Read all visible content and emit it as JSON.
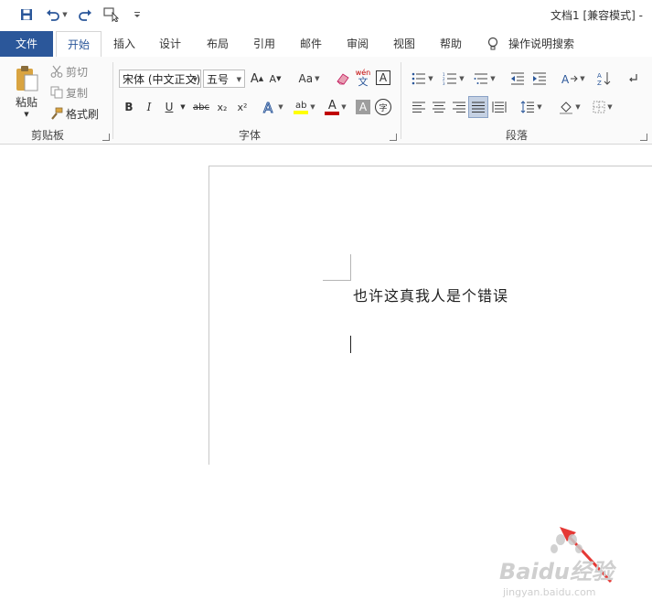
{
  "title_bar": {
    "doc_title": "文档1 [兼容模式] -"
  },
  "tabs": [
    "文件",
    "开始",
    "插入",
    "设计",
    "布局",
    "引用",
    "邮件",
    "审阅",
    "视图",
    "帮助"
  ],
  "tell_me": "操作说明搜索",
  "clipboard": {
    "paste": "粘贴",
    "cut": "剪切",
    "copy": "复制",
    "format_painter": "格式刷",
    "label": "剪贴板"
  },
  "font": {
    "font_name": "宋体 (中文正文)",
    "font_size": "五号",
    "change_case": "Aa",
    "phonetic_top": "wén",
    "phonetic_bottom": "文",
    "border_char": "A",
    "bold": "B",
    "italic": "I",
    "underline": "U",
    "strike": "abc",
    "subscript": "x₂",
    "superscript": "x²",
    "highlight_text": "ab",
    "font_color_text": "A",
    "shading_char": "A",
    "enclose_char": "字",
    "label": "字体"
  },
  "paragraph": {
    "label": "段落"
  },
  "document": {
    "text": "也许这真我人是个错误"
  },
  "watermark": {
    "brand": "Baidu经验",
    "url": "jingyan.baidu.com"
  },
  "colors": {
    "accent": "#2b579a",
    "highlight": "#ffff00",
    "font_color": "#c00000",
    "arrow": "#e53935"
  }
}
